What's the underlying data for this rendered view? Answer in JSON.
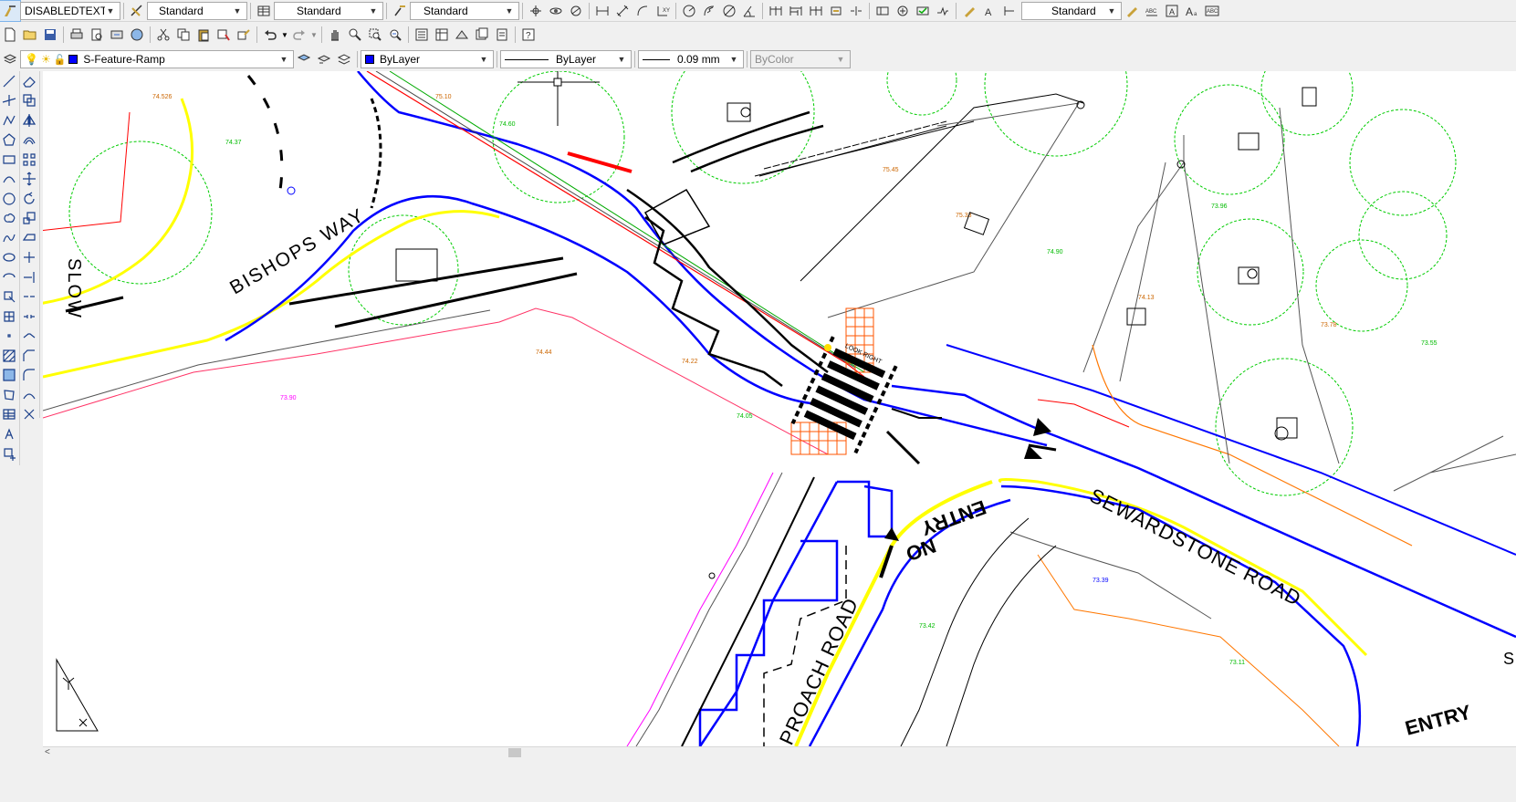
{
  "toolbars": {
    "text_style": "DISABLEDTEXT",
    "dim_style": "Standard",
    "table_style": "Standard",
    "multileader_style": "Standard",
    "annotation_scale": "Standard"
  },
  "layers": {
    "current_layer": "S-Feature-Ramp",
    "color": "ByLayer",
    "linetype": "ByLayer",
    "lineweight": "0.09 mm",
    "plot_style": "ByColor"
  },
  "drawing": {
    "labels": {
      "bishops_way": "BISHOPS WAY",
      "slow": "SLOW",
      "sewardstone_road": "SEWARDSTONE ROAD",
      "approach_road": "PROACH ROAD",
      "entry_marking": "ENTRY",
      "no_marking": "NO",
      "entry_marking_bottom": "ENTRY",
      "sign_text": "LOOK RIGHT",
      "edge_s": "S"
    },
    "colors": {
      "road_edge": "#0000ff",
      "kerb_line": "#ffff00",
      "trees": "#00cc00",
      "levels_green": "#00bb00",
      "levels_orange": "#cc6600",
      "boundary_red": "#ff0000",
      "fence_magenta": "#ff00ff",
      "crossing": "#ff3300",
      "black_lines": "#000000",
      "grey_lines": "#555555"
    }
  },
  "icons": {
    "draw_toolbar": [
      "line-icon",
      "construction-line-icon",
      "polyline-icon",
      "polygon-icon",
      "rectangle-icon",
      "arc-icon",
      "circle-icon",
      "revision-cloud-icon",
      "spline-icon",
      "ellipse-icon",
      "ellipse-arc-icon",
      "insert-block-icon",
      "make-block-icon",
      "point-icon",
      "hatch-icon",
      "gradient-icon",
      "region-icon",
      "table-icon",
      "multiline-text-icon",
      "add-selected-icon"
    ],
    "modify_toolbar": [
      "erase-icon",
      "copy-icon",
      "mirror-icon",
      "offset-icon",
      "array-icon",
      "move-icon",
      "rotate-icon",
      "scale-icon",
      "stretch-icon",
      "trim-icon",
      "extend-icon",
      "break-at-point-icon",
      "break-icon",
      "join-icon",
      "chamfer-icon",
      "fillet-icon",
      "blend-icon",
      "explode-icon"
    ]
  }
}
